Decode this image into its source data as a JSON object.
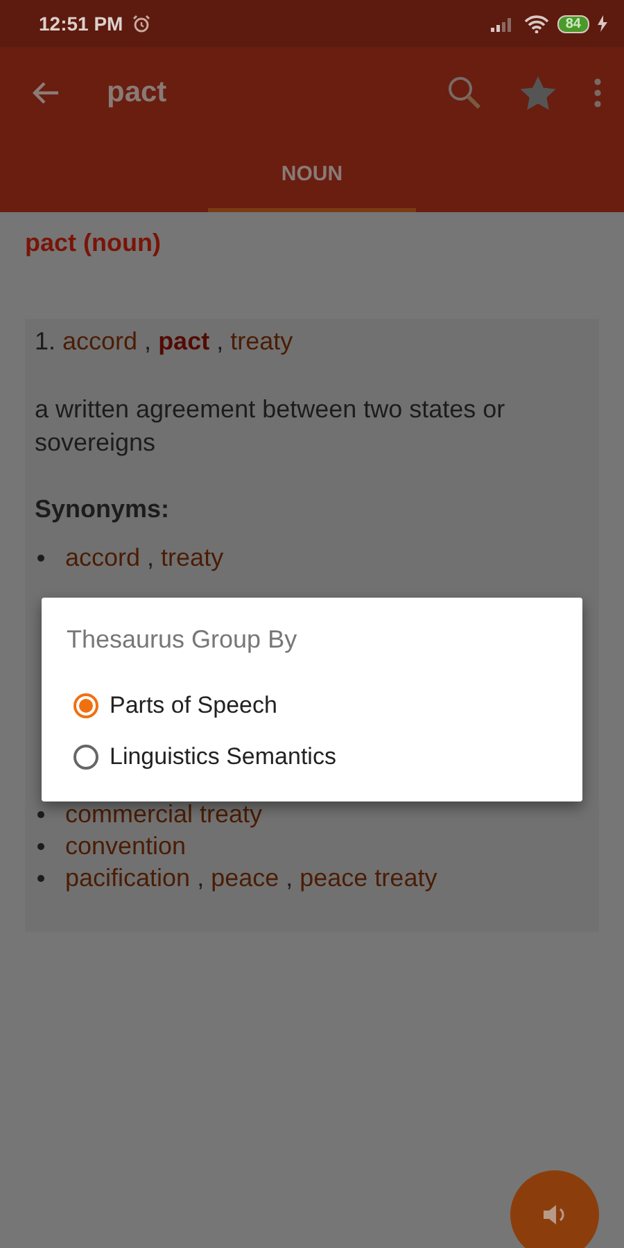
{
  "status_bar": {
    "time": "12:51 PM",
    "battery": "84"
  },
  "app_bar": {
    "title": "pact"
  },
  "tabs": [
    {
      "label": "NOUN",
      "selected": true
    }
  ],
  "entry": {
    "heading": "pact (noun)",
    "sense": {
      "number": "1.",
      "words": [
        {
          "text": "accord",
          "kind": "link"
        },
        {
          "text": ",",
          "kind": "sep"
        },
        {
          "text": "pact",
          "kind": "current"
        },
        {
          "text": ",",
          "kind": "sep"
        },
        {
          "text": "treaty",
          "kind": "link"
        }
      ],
      "definition": "a written agreement between two states or sovereigns",
      "synonyms_label": "Synonyms:",
      "synonyms": [
        [
          {
            "text": "accord",
            "kind": "link"
          },
          {
            "text": ",",
            "kind": "sep"
          },
          {
            "text": "treaty",
            "kind": "link"
          }
        ]
      ],
      "related": [
        [
          {
            "text": "commercial treaty",
            "kind": "link"
          }
        ],
        [
          {
            "text": "convention",
            "kind": "link"
          }
        ],
        [
          {
            "text": "pacification",
            "kind": "link"
          },
          {
            "text": ",",
            "kind": "sep"
          },
          {
            "text": "peace",
            "kind": "link"
          },
          {
            "text": ",",
            "kind": "sep"
          },
          {
            "text": "peace treaty",
            "kind": "link"
          }
        ]
      ]
    }
  },
  "dialog": {
    "title": "Thesaurus Group By",
    "options": [
      {
        "label": "Parts of Speech",
        "selected": true
      },
      {
        "label": "Linguistics Semantics",
        "selected": false
      }
    ]
  }
}
